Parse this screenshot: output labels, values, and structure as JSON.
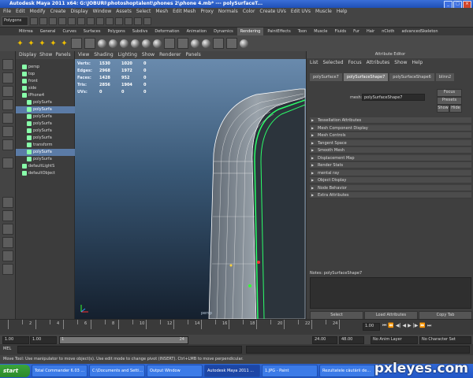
{
  "window": {
    "title": "Autodesk Maya 2011 x64: G:\\JOBURI\\photoshoptalent\\phones 2\\phone 4.mb* --- polySurfaceT..."
  },
  "menubar": [
    "File",
    "Edit",
    "Modify",
    "Create",
    "Display",
    "Window",
    "Assets",
    "Select",
    "Mesh",
    "Edit Mesh",
    "Proxy",
    "Normals",
    "Color",
    "Create UVs",
    "Edit UVs",
    "Muscle",
    "Help"
  ],
  "statusline": {
    "mode": "Polygons"
  },
  "shelf_tabs": [
    "Mitrrea",
    "General",
    "Curves",
    "Surfaces",
    "Polygons",
    "Subdivs",
    "Deformation",
    "Animation",
    "Dynamics",
    "Rendering",
    "PaintEffects",
    "Toon",
    "Muscle",
    "Fluids",
    "Fur",
    "Hair",
    "nCloth",
    "advancedSkeleton"
  ],
  "shelf_active": "Rendering",
  "outliner": {
    "menu": [
      "Display",
      "Show",
      "Panels"
    ],
    "items": [
      {
        "label": "persp",
        "selected": false
      },
      {
        "label": "top",
        "selected": false
      },
      {
        "label": "front",
        "selected": false
      },
      {
        "label": "side",
        "selected": false
      },
      {
        "label": "iPhone4",
        "selected": false
      },
      {
        "label": "polySurfa",
        "selected": false
      },
      {
        "label": "polySurfa",
        "selected": true
      },
      {
        "label": "polySurfa",
        "selected": false
      },
      {
        "label": "polySurfa",
        "selected": false
      },
      {
        "label": "polySurfa",
        "selected": false
      },
      {
        "label": "polySurfa",
        "selected": false
      },
      {
        "label": "transform",
        "selected": false
      },
      {
        "label": "polySurfa",
        "selected": true
      },
      {
        "label": "polySurfa",
        "selected": false
      },
      {
        "label": "defaultLightS",
        "selected": false
      },
      {
        "label": "defaultObject",
        "selected": false
      }
    ]
  },
  "viewport": {
    "menu": [
      "View",
      "Shading",
      "Lighting",
      "Show",
      "Renderer",
      "Panels"
    ],
    "hud": [
      {
        "label": "Verts:",
        "a": "1530",
        "b": "1020",
        "c": "0"
      },
      {
        "label": "Edges:",
        "a": "2968",
        "b": "1972",
        "c": "0"
      },
      {
        "label": "Faces:",
        "a": "1428",
        "b": "952",
        "c": "0"
      },
      {
        "label": "Tris:",
        "a": "2856",
        "b": "1904",
        "c": "0"
      },
      {
        "label": "UVs:",
        "a": "0",
        "b": "0",
        "c": "0"
      }
    ],
    "camera": "persp"
  },
  "attribute_editor": {
    "title": "Attribute Editor",
    "menu": [
      "List",
      "Selected",
      "Focus",
      "Attributes",
      "Show",
      "Help"
    ],
    "tabs": [
      "polySurface7",
      "polySurfaceShape7",
      "polySurfaceShape6",
      "blinn2"
    ],
    "active_tab": "polySurfaceShape7",
    "mesh_label": "mesh:",
    "mesh_value": "polySurfaceShape7",
    "buttons": [
      "Focus",
      "Presets",
      "Show",
      "Hide"
    ],
    "sections": [
      "Tessellation Attributes",
      "Mesh Component Display",
      "Mesh Controls",
      "Tangent Space",
      "Smooth Mesh",
      "Displacement Map",
      "Render Stats",
      "mental ray",
      "Object Display",
      "Node Behavior",
      "Extra Attributes"
    ],
    "notes_label": "Notes: polySurfaceShape7",
    "bottom_buttons": [
      "Select",
      "Load Attributes",
      "Copy Tab"
    ]
  },
  "timeline": {
    "ticks": [
      "2",
      "4",
      "6",
      "8",
      "10",
      "12",
      "14",
      "16",
      "18",
      "20",
      "22",
      "24"
    ],
    "current_frame": "1.00"
  },
  "range": {
    "start": "1.00",
    "start2": "1.00",
    "slider_label": "1",
    "slider_end": "24",
    "end": "24.00",
    "end2": "48.00",
    "anim_layer": "No Anim Layer",
    "char_set": "No Character Set"
  },
  "cmdline": {
    "label": "MEL"
  },
  "helpline": {
    "text": "Move Tool: Use manipulator to move object(s). Use edit mode to change pivot (INSERT). Ctrl+LMB to move perpendicular."
  },
  "taskbar": {
    "start": "start",
    "items": [
      {
        "label": "Total Commander 6.03 ...",
        "active": false
      },
      {
        "label": "C:\\Documents and Setti...",
        "active": false
      },
      {
        "label": "Output Window",
        "active": false
      },
      {
        "label": "Autodesk Maya 2011 ...",
        "active": true
      },
      {
        "label": "1.JPG - Paint",
        "active": false
      },
      {
        "label": "Rezultatele cãutării de...",
        "active": false
      }
    ]
  },
  "watermark": "pxleyes.com"
}
